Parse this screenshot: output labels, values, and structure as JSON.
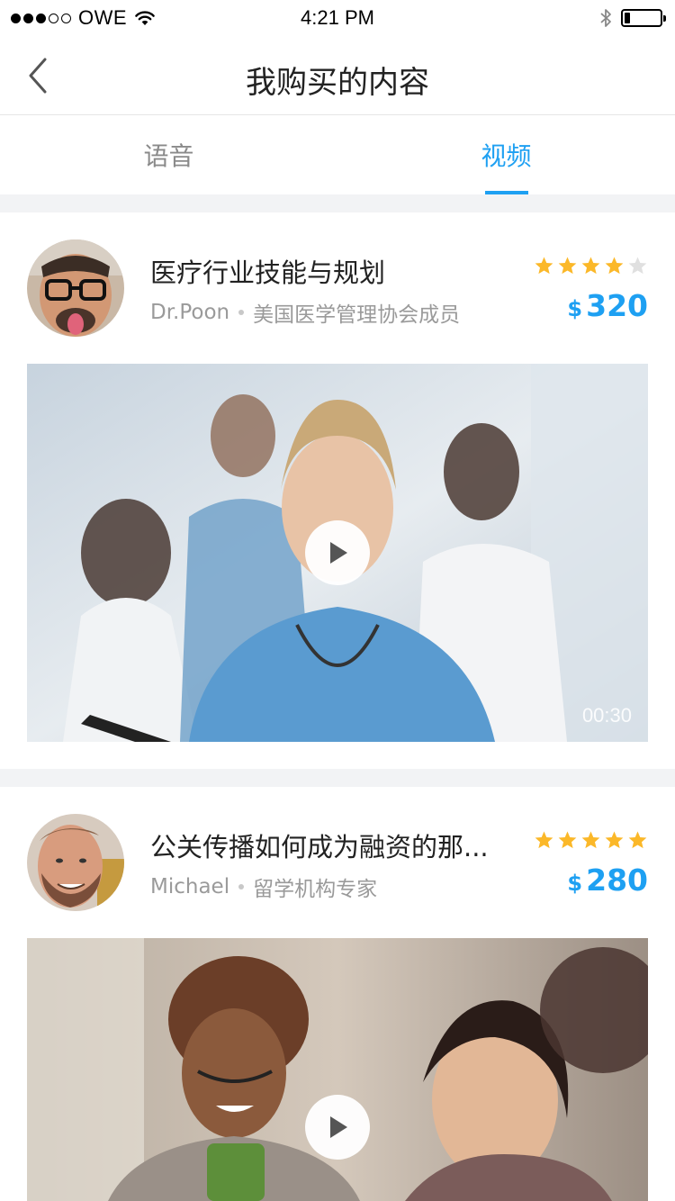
{
  "status_bar": {
    "carrier": "OWE",
    "time": "4:21 PM",
    "battery_level": 0.15,
    "signal_strength": 3,
    "signal_max": 5
  },
  "nav": {
    "title": "我购买的内容",
    "back_icon": "chevron-left-icon"
  },
  "tabs": [
    {
      "label": "语音",
      "active": false
    },
    {
      "label": "视频",
      "active": true
    }
  ],
  "colors": {
    "accent": "#1ea0f2",
    "star_filled": "#fbb829",
    "star_empty": "#e0e0e0",
    "separator": "#f2f3f5"
  },
  "courses": [
    {
      "title": "医疗行业技能与规划",
      "author": "Dr.Poon",
      "author_title": "美国医学管理协会成员",
      "rating": 4,
      "rating_max": 5,
      "price_currency": "$",
      "price": "320",
      "duration": "00:30"
    },
    {
      "title": "公关传播如何成为融资的那...",
      "author": "Michael",
      "author_title": "留学机构专家",
      "rating": 5,
      "rating_max": 5,
      "price_currency": "$",
      "price": "280",
      "duration": ""
    }
  ]
}
